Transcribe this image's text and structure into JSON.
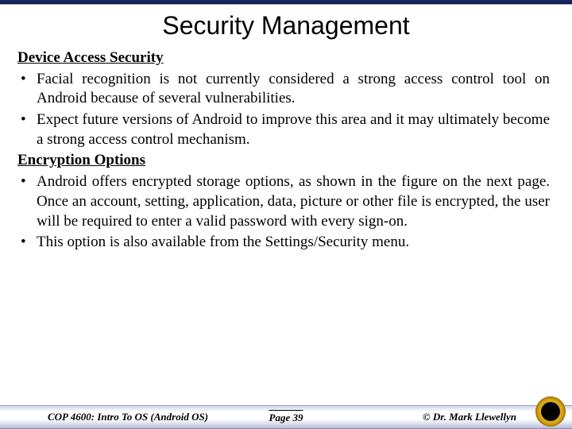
{
  "title": "Security Management",
  "sections": [
    {
      "heading": "Device Access Security",
      "bullets": [
        "Facial recognition is not currently considered a strong access control tool on Android because of several vulnerabilities.",
        "Expect future versions of Android to improve this area and it may ultimately become a strong access control mechanism."
      ]
    },
    {
      "heading": "Encryption Options",
      "bullets": [
        "Android offers encrypted storage options, as shown in the figure on the next page.  Once an account, setting, application, data, picture or other file is encrypted, the user will be required to enter a valid password with every sign-on.",
        "This option is also available from the Settings/Security menu."
      ]
    }
  ],
  "footer": {
    "course": "COP 4600: Intro To OS  (Android OS)",
    "page": "Page 39",
    "copyright": "© Dr. Mark Llewellyn"
  }
}
